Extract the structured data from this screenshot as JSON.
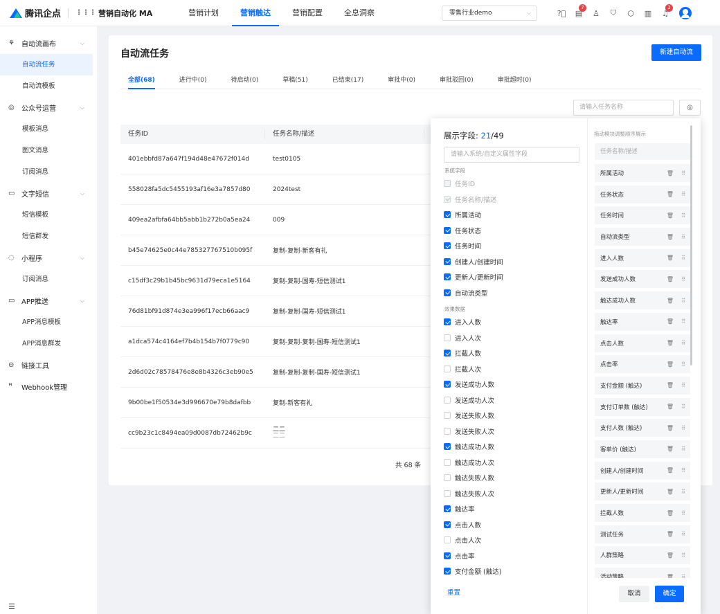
{
  "header": {
    "brand": "腾讯企点",
    "app_name": "营销自动化 MA",
    "nav": [
      "营销计划",
      "营销触达",
      "营销配置",
      "全息洞察"
    ],
    "tenant": "零售行业demo",
    "badges": {
      "tasks": "7",
      "notify": "2"
    }
  },
  "sidebar": {
    "groups": [
      {
        "label": "自动流画布",
        "items": [
          "自动流任务",
          "自动流模板"
        ]
      },
      {
        "label": "公众号运营",
        "items": [
          "模板消息",
          "图文消息",
          "订阅消息"
        ]
      },
      {
        "label": "文字短信",
        "items": [
          "短信模板",
          "短信群发"
        ]
      },
      {
        "label": "小程序",
        "items": [
          "订阅消息"
        ]
      },
      {
        "label": "APP推送",
        "items": [
          "APP消息模板",
          "APP消息群发"
        ]
      },
      {
        "label": "链接工具",
        "items": []
      },
      {
        "label": "Webhook管理",
        "items": []
      }
    ]
  },
  "main": {
    "title": "自动流任务",
    "new_button": "新建自动流",
    "tabs": [
      "全部(68)",
      "进行中(0)",
      "待启动(0)",
      "草稿(51)",
      "已结束(17)",
      "审批中(0)",
      "审批驳回(0)",
      "审批超时(0)"
    ],
    "search_placeholder": "请输入任务名称",
    "columns": [
      "任务ID",
      "任务名称/描述"
    ],
    "rows": [
      {
        "id": "401ebbfd87a647f194d48e47672f014d",
        "name": "test0105"
      },
      {
        "id": "558028fa5dc5455193af16e3a7857d80",
        "name": "2024test"
      },
      {
        "id": "409ea2afbfa64bb5abb1b272b0a5ea24",
        "name": "009"
      },
      {
        "id": "b45e74625e0c44e785327767510b095f",
        "name": "复制-复制-新客有礼"
      },
      {
        "id": "c15df3c29b1b45bc9631d79eca1e5164",
        "name": "复制-复制-国寿-短信测试1"
      },
      {
        "id": "76d81bf91d874e3ea996f17ecb66aac9",
        "name": "复制-复制-国寿-短信测试1"
      },
      {
        "id": "a1dca574c4164ef7b4b154b7f0779c90",
        "name": "复制-复制-复制-国寿-短信测试1"
      },
      {
        "id": "2d6d02c78578476e8e8b4326c3eb90e5",
        "name": "复制-复制-复制-国寿-短信测试1"
      },
      {
        "id": "9b00be1f50534e3d996670e79b8dafbb",
        "name": "复制-新客有礼"
      },
      {
        "id": "cc9b23c1c8494ea09d0087db72462b9c",
        "name": "二二",
        "desc": "二二"
      }
    ],
    "total": "共 68 条"
  },
  "panel": {
    "title": "展示字段: ",
    "selected": "21",
    "total": "/49",
    "search_placeholder": "请输入系统/自定义属性字段",
    "sys_label": "系统字段",
    "perf_label": "效果数据",
    "sys_fields": [
      {
        "label": "任务ID",
        "state": "off-disabled"
      },
      {
        "label": "任务名称/描述",
        "state": "disabled"
      },
      {
        "label": "所属活动",
        "state": "on"
      },
      {
        "label": "任务状态",
        "state": "on"
      },
      {
        "label": "任务时间",
        "state": "on"
      },
      {
        "label": "创建人/创建时间",
        "state": "on"
      },
      {
        "label": "更新人/更新时间",
        "state": "on"
      },
      {
        "label": "自动流类型",
        "state": "on"
      }
    ],
    "perf_fields": [
      {
        "label": "进入人数",
        "state": "on"
      },
      {
        "label": "进入人次",
        "state": "off"
      },
      {
        "label": "拦截人数",
        "state": "on"
      },
      {
        "label": "拦截人次",
        "state": "off"
      },
      {
        "label": "发送成功人数",
        "state": "on"
      },
      {
        "label": "发送成功人次",
        "state": "off"
      },
      {
        "label": "发送失败人数",
        "state": "off"
      },
      {
        "label": "发送失败人次",
        "state": "off"
      },
      {
        "label": "触达成功人数",
        "state": "on"
      },
      {
        "label": "触达成功人次",
        "state": "off"
      },
      {
        "label": "触达失败人数",
        "state": "off"
      },
      {
        "label": "触达失败人次",
        "state": "off"
      },
      {
        "label": "触达率",
        "state": "on"
      },
      {
        "label": "点击人数",
        "state": "on"
      },
      {
        "label": "点击人次",
        "state": "off"
      },
      {
        "label": "点击率",
        "state": "on"
      },
      {
        "label": "支付金额 (触达)",
        "state": "on"
      }
    ],
    "reset": "重置",
    "order_hint": "拖动模块调整顺序展示",
    "fixed_field": "任务名称/描述",
    "order_list": [
      "所属活动",
      "任务状态",
      "任务时间",
      "自动流类型",
      "进入人数",
      "发送成功人数",
      "触达成功人数",
      "触达率",
      "点击人数",
      "点击率",
      "支付金额 (触达)",
      "支付订单数 (触达)",
      "支付人数 (触达)",
      "客单价 (触达)",
      "创建人/创建时间",
      "更新人/更新时间",
      "拦截人数",
      "测试任务",
      "人群策略",
      "活动策略"
    ],
    "cancel": "取消",
    "ok": "确定"
  }
}
